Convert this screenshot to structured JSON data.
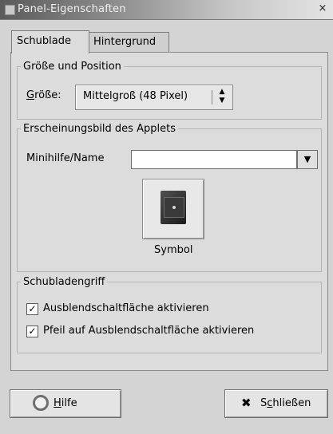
{
  "window": {
    "title": "Panel-Eigenschaften",
    "close_glyph": "×"
  },
  "tabs": [
    {
      "label": "Schublade",
      "active": true
    },
    {
      "label": "Hintergrund",
      "active": false
    }
  ],
  "size_group": {
    "legend": "Größe und Position",
    "size_label_mnemonic": "G",
    "size_label_rest": "röße:",
    "size_value": "Mittelgroß (48 Pixel)",
    "spin_glyph": "▲▼"
  },
  "appearance_group": {
    "legend": "Erscheinungsbild des Applets",
    "name_label": "Minihilfe/Name",
    "name_value": "",
    "dropdown_glyph": "▼",
    "symbol_label": "Symbol",
    "symbol_icon": "drawer-icon"
  },
  "handle_group": {
    "legend": "Schubladengriff",
    "checkboxes": [
      {
        "label": "Ausblendschaltfläche aktivieren",
        "checked": true
      },
      {
        "label": "Pfeil auf Ausblendschaltfläche aktivieren",
        "checked": true
      }
    ]
  },
  "buttons": {
    "help_mnemonic": "H",
    "help_rest": "ilfe",
    "close_prefix": "S",
    "close_mnemonic": "c",
    "close_rest": "hließen",
    "close_glyph": "✖"
  }
}
